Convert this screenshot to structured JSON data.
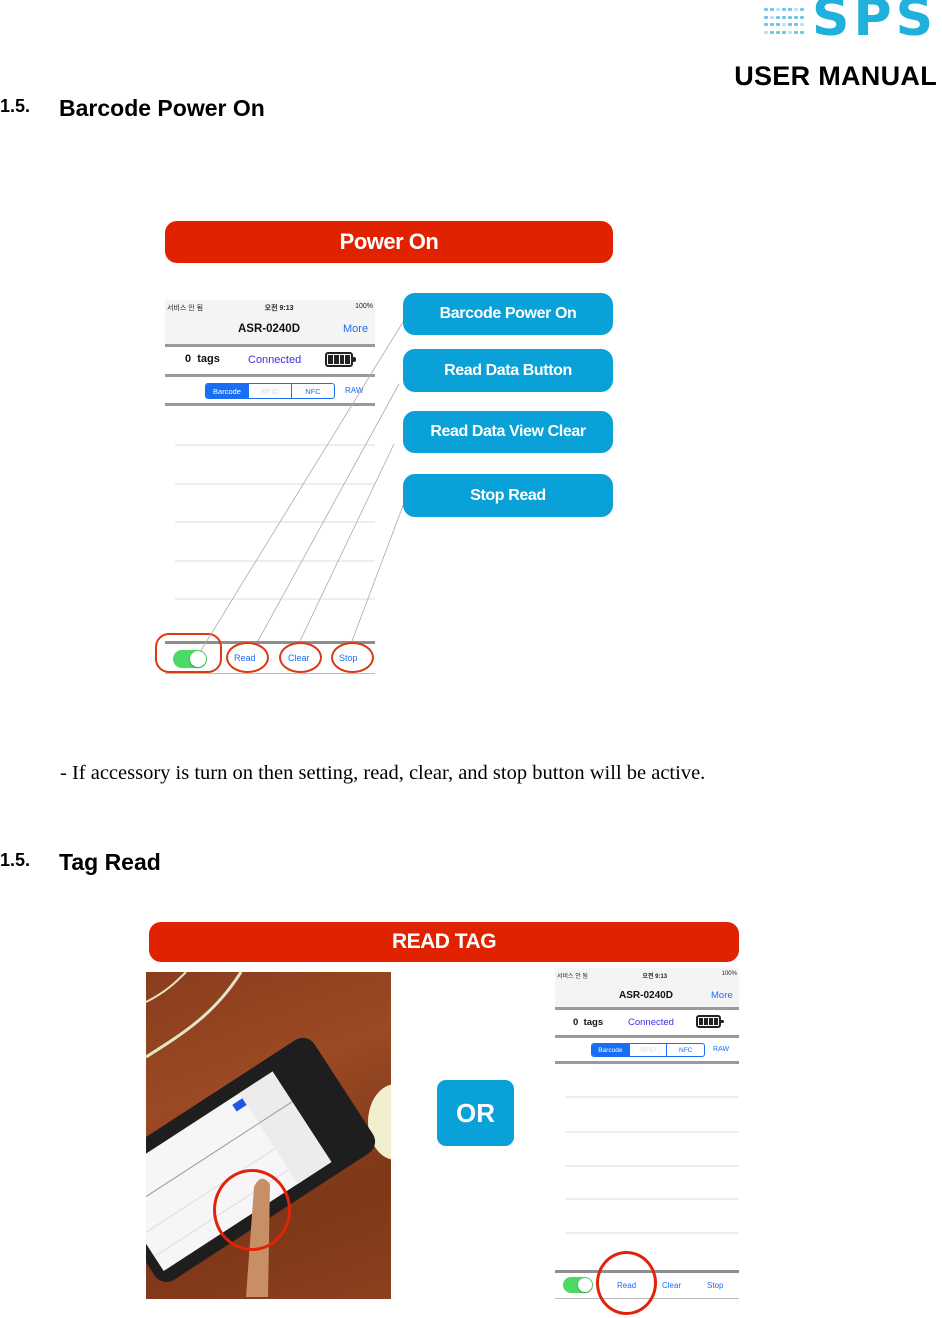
{
  "header": {
    "logo_text": "SPS",
    "manual_title": "USER MANUAL"
  },
  "section1": {
    "number": "1.5.",
    "title": "Barcode Power On",
    "banner": "Power On",
    "callouts": [
      {
        "label": "Barcode Power On"
      },
      {
        "label": "Read Data Button"
      },
      {
        "label": "Read Data View Clear"
      },
      {
        "label": "Stop Read"
      }
    ],
    "bullet": "-  If accessory is turn on then setting, read, clear, and stop button will be active."
  },
  "phone": {
    "carrier": "서비스 안 됨",
    "time": "오전 9:13",
    "battery_pct": "100%",
    "device_title": "ASR-0240D",
    "more": "More",
    "tags_count": "0",
    "tags_label": "tags",
    "status": "Connected",
    "segments": [
      "Barcode",
      "RFID",
      "NFC"
    ],
    "raw": "RAW",
    "toggle_on": true,
    "actions": [
      "Read",
      "Clear",
      "Stop"
    ]
  },
  "section2": {
    "number": "1.5.",
    "title": "Tag Read",
    "banner": "READ TAG",
    "or_label": "OR"
  },
  "colors": {
    "banner_red": "#e02200",
    "callout_blue": "#0aa1d8",
    "ios_blue": "#1a6ef5",
    "toggle_green": "#4cd964",
    "logo_cyan": "#1fb0dc"
  }
}
